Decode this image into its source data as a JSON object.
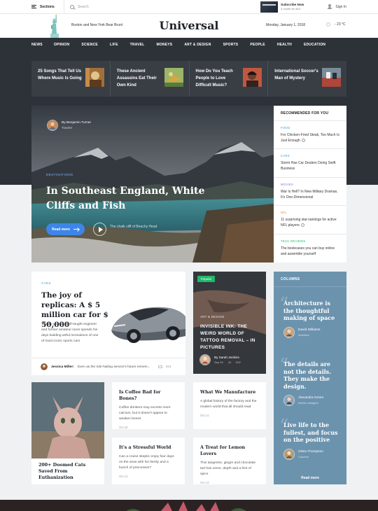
{
  "topbar": {
    "sections_label": "Sections",
    "search_placeholder": "Search",
    "subscribe_title": "Subscribe Now",
    "subscribe_price": "3 month for $19",
    "signin_label": "Sign In"
  },
  "masthead": {
    "city_label": "Boston and New York Bear Brunt",
    "logo": "Universal",
    "date": "Monday, January 1, 2018",
    "temperature": "- 23 °C"
  },
  "nav": [
    "NEWS",
    "OPINION",
    "SCIENCE",
    "LIFE",
    "TRAVEL",
    "MONEYS",
    "ART & DESIGN",
    "SPORTS",
    "PEOPLE",
    "HEALTH",
    "EDUCATION"
  ],
  "trending": [
    {
      "title": "25 Songs That Tell Us Where Music Is Going"
    },
    {
      "title": "These Ancient Assassins Eat Their Own Kind"
    },
    {
      "title": "How Do You Teach People to Love Difficult Music?"
    },
    {
      "title": "International Soccer's Man of Mystery"
    }
  ],
  "hero": {
    "author_prefix": "By Benjamin Turner",
    "author_role": "Traveler",
    "category": "DESTINATIONS",
    "title": "In Southeast England, White Cliffs and Fish",
    "read_more": "Read more",
    "caption": "The chalk cliff of Beachy Head"
  },
  "recommended": {
    "heading": "RECOMMENDED FOR YOU",
    "items": [
      {
        "category": "FOOD",
        "title": "For Chicken-Fried Steak, Too Much Is Just Enough",
        "color": "#3a9ad9"
      },
      {
        "category": "CARS",
        "title": "Storm Has Car Dealers Doing Swift Business",
        "color": "#3a9ad9"
      },
      {
        "category": "MOVIES",
        "title": "War Is Hell? In New Military Dramas, It's One-Dimensional",
        "color": "#8b6dd1"
      },
      {
        "category": "NFL",
        "title": "11 surprising stat rankings for active NFL players",
        "color": "#f08a2b"
      },
      {
        "category": "TECH REVIEWS",
        "title": "The bookcases you can buy online and assemble yourself",
        "color": "#1fb96a"
      }
    ]
  },
  "cars_card": {
    "category": "CARS",
    "title": "The joy of replicas: A $ 5 million car for $ 50,000",
    "description": "The 31-year-old self-taught engineer and former amateur racer spends his days building artful recreations of one of most iconic sports cars",
    "author": "Jessica Miller:",
    "comment_preview": "Even as the ride-hailing service's future remem...",
    "comment_count": "341"
  },
  "ink_card": {
    "badge": "Popular",
    "category": "ART & DESIGN",
    "title": "INVISIBLE INK: THE WEIRD WORLD OF TATTOO REMOVAL – IN PICTURES",
    "author": "By Sarah Jenkins",
    "date": "Sep 26",
    "comments": "16",
    "likes": "832"
  },
  "columns": {
    "heading": "COLUMNS",
    "items": [
      {
        "quote": "Architecture is the thoughtful making of space",
        "author": "David Williams",
        "role": "Architect"
      },
      {
        "quote": "The details are not the details. They make the design.",
        "author": "Alexandra Green",
        "role": "Interior designer"
      },
      {
        "quote": "Live life to the fullest, and focus on the positive",
        "author": "Olivia Thompson",
        "role": "Coacher"
      }
    ],
    "more_label": "Read more"
  },
  "cat_card": {
    "title": "200+ Doomed Cats Saved From Euthanization"
  },
  "articles": [
    {
      "title": "Is Coffee Bad for Bones?",
      "description": "Coffee drinkers may excrete more calcium, but it doesn't appear to weaken bones",
      "date": "Oct 15"
    },
    {
      "title": "What We Manufacture",
      "description": "A global history of the factory and the modern world that all should read",
      "date": "Oct 14"
    },
    {
      "title": "It's a Stressful World",
      "description": "Can a cruise skeptic enjoy four days on the seas with his family and a bunch of princesses?",
      "date": "Oct 14"
    },
    {
      "title": "A Treat for Lemon Lovers",
      "description": "This tangerine, ginger and chocolate tart has verve, depth and a hint of spice",
      "date": "Oct 13"
    }
  ]
}
